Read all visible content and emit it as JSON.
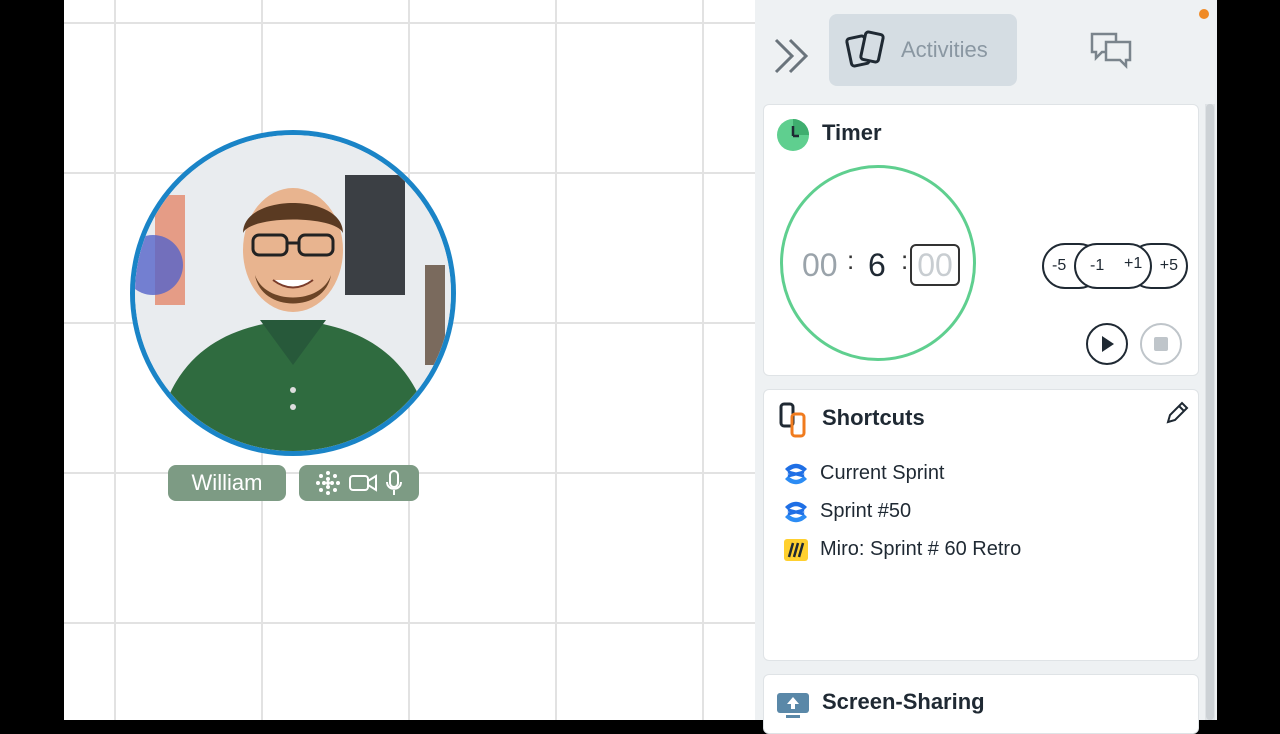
{
  "participant": {
    "name": "William"
  },
  "panel": {
    "tab_activities_label": "Activities"
  },
  "timer": {
    "title": "Timer",
    "hours": "00",
    "minutes": "6",
    "seconds_field": "00",
    "adjust": [
      "-5",
      "-1",
      "+1",
      "+5"
    ]
  },
  "shortcuts": {
    "title": "Shortcuts",
    "items": [
      {
        "label": "Current Sprint",
        "icon": "confluence-icon"
      },
      {
        "label": "Sprint #50",
        "icon": "confluence-icon"
      },
      {
        "label": "Miro: Sprint # 60 Retro",
        "icon": "miro-icon"
      }
    ]
  },
  "screen_sharing": {
    "title": "Screen-Sharing"
  },
  "colors": {
    "accent_green": "#5fcf8f",
    "avatar_ring": "#1a84c7",
    "tag_bg": "#7d9b84",
    "confluence_blue": "#1f6fe5",
    "miro_yellow": "#ffd02f"
  }
}
